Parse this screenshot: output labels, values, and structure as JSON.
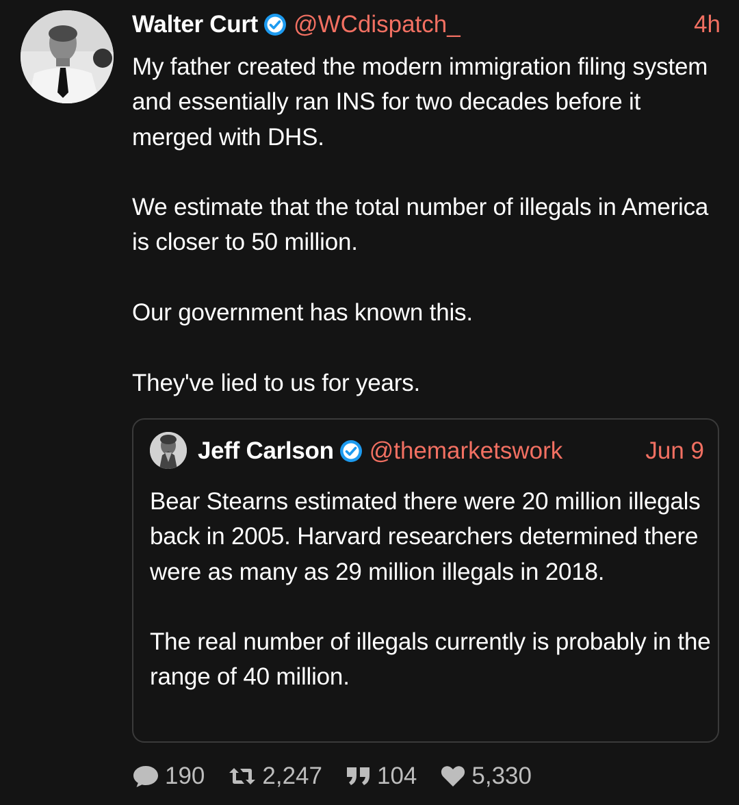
{
  "tweet": {
    "author_name": "Walter Curt",
    "handle": "@WCdispatch_",
    "time": "4h",
    "verified": true,
    "text": "My father created the modern immigration filing system and essentially ran INS for two decades before it merged with DHS.\n\nWe estimate that the total number of illegals in America is closer to 50 million.\n\nOur government has known this.\n\nThey've lied to us for years."
  },
  "quoted_tweet": {
    "author_name": "Jeff Carlson",
    "handle": "@themarketswork",
    "time": "Jun 9",
    "verified": true,
    "text": "Bear Stearns estimated there were 20 million illegals back in 2005. Harvard researchers determined there were as many as 29 million illegals in 2018.\n\nThe real number of illegals currently is probably in the range of 40 million."
  },
  "stats": {
    "replies": "190",
    "retweets": "2,247",
    "quotes": "104",
    "likes": "5,330"
  },
  "colors": {
    "background": "#141414",
    "accent": "#f27062",
    "verified_badge": "#1d9bf0",
    "muted": "#bdbdbd",
    "quote_border": "#3a3a3a"
  },
  "icons": {
    "verified": "verified-badge-icon",
    "reply": "speech-bubble-icon",
    "retweet": "retweet-arrows-icon",
    "quote": "quote-marks-icon",
    "like": "heart-icon"
  }
}
